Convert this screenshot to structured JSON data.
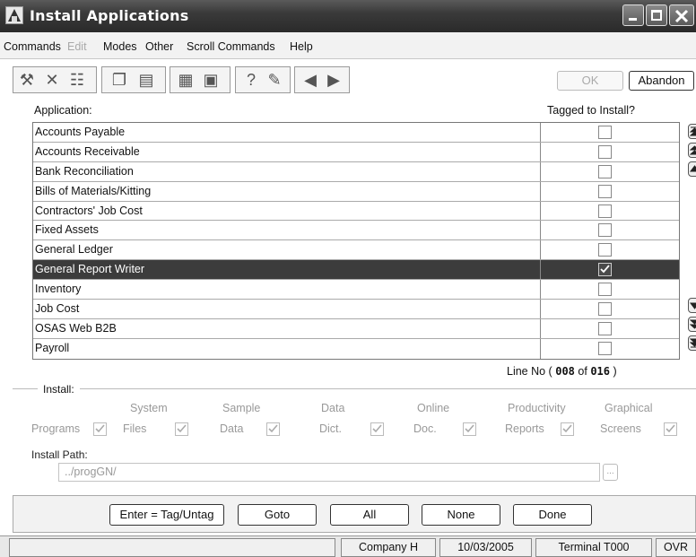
{
  "window": {
    "title": "Install Applications"
  },
  "menu": {
    "items": [
      "Commands",
      "Edit",
      "Modes",
      "Other",
      "Scroll Commands",
      "Help"
    ]
  },
  "toolbar": {
    "ok_label": "OK",
    "abandon_label": "Abandon",
    "icons": [
      "hammer-wrench-icon",
      "delete-icon",
      "list-icon",
      "copy-icon",
      "paste-icon",
      "calculator-icon",
      "calendar-icon",
      "help-icon",
      "notes-icon",
      "back-icon",
      "forward-icon"
    ]
  },
  "grid": {
    "col_application": "Application:",
    "col_tagged": "Tagged to Install?",
    "rows": [
      {
        "name": "Accounts Payable",
        "tagged": false
      },
      {
        "name": "Accounts Receivable",
        "tagged": false
      },
      {
        "name": "Bank Reconciliation",
        "tagged": false
      },
      {
        "name": "Bills of Materials/Kitting",
        "tagged": false
      },
      {
        "name": "Contractors' Job Cost",
        "tagged": false
      },
      {
        "name": "Fixed Assets",
        "tagged": false
      },
      {
        "name": "General Ledger",
        "tagged": false
      },
      {
        "name": "General Report Writer",
        "tagged": true,
        "selected": true
      },
      {
        "name": "Inventory",
        "tagged": false
      },
      {
        "name": "Job Cost",
        "tagged": false
      },
      {
        "name": "OSAS Web B2B",
        "tagged": false
      },
      {
        "name": "Payroll",
        "tagged": false
      }
    ],
    "selected_color": "#3c3c3c"
  },
  "lineno": {
    "prefix": "Line No (",
    "current": "008",
    "of": "of",
    "total": "016",
    "suffix": ")"
  },
  "install": {
    "label": "Install:",
    "programs": "Programs",
    "system_top": "System",
    "system_bottom": "Files",
    "sample_top": "Sample",
    "sample_bottom": "Data",
    "data_top": "Data",
    "data_bottom": "Dict.",
    "online_top": "Online",
    "online_bottom": "Doc.",
    "productivity_top": "Productivity",
    "productivity_bottom": "Reports",
    "graphical_top": "Graphical",
    "graphical_bottom": "Screens",
    "path_label": "Install Path:",
    "path_value": "../progGN/",
    "browse": "..."
  },
  "buttons": {
    "tag": "Enter = Tag/Untag",
    "goto": "Goto",
    "all": "All",
    "none": "None",
    "done": "Done"
  },
  "status": {
    "company": "Company H",
    "date": "10/03/2005",
    "terminal": "Terminal T000",
    "mode": "OVR"
  }
}
